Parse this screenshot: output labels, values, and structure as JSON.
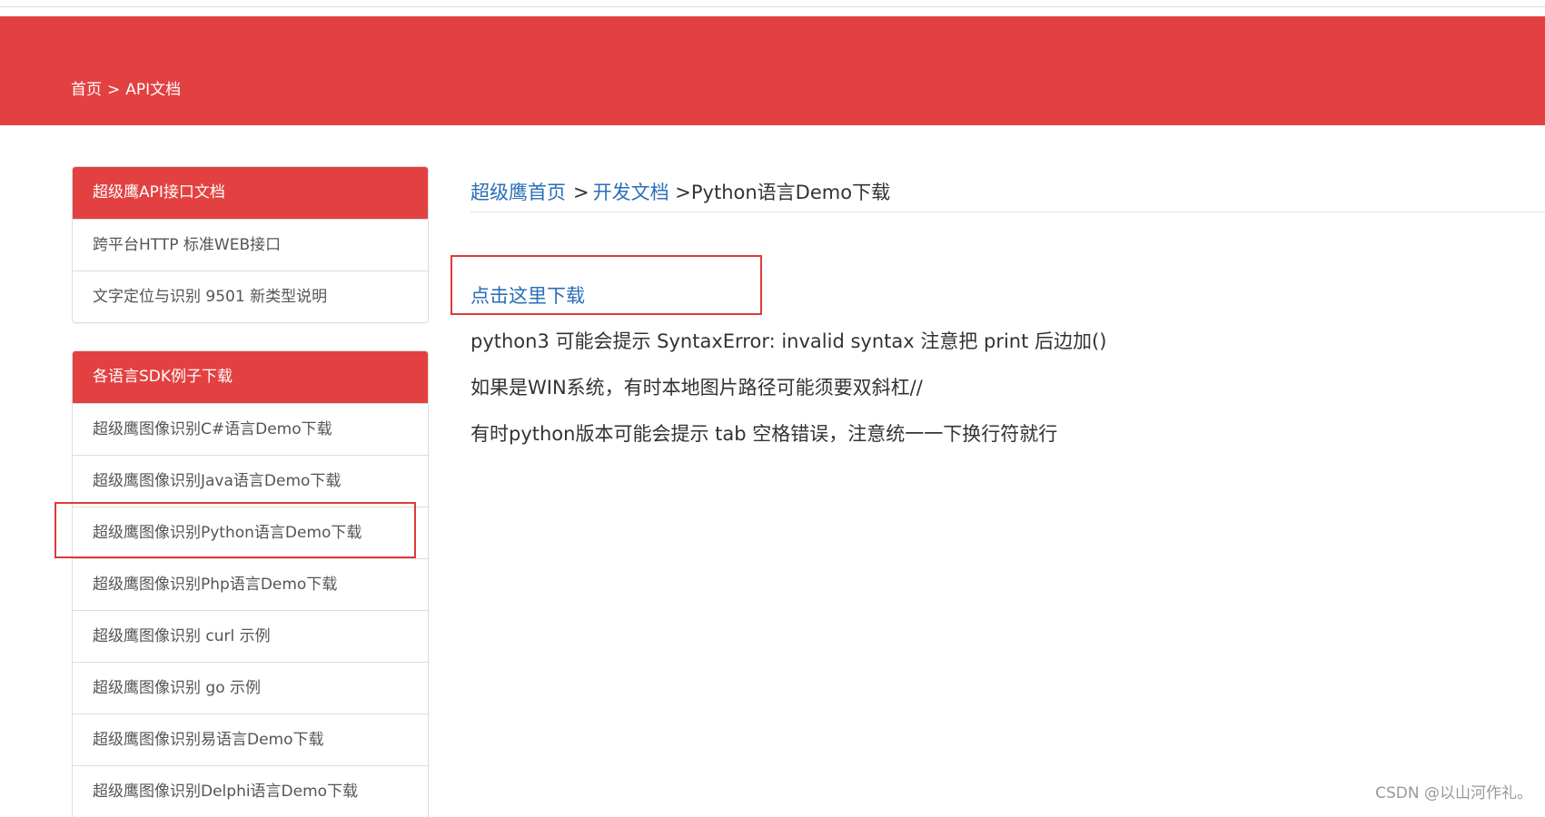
{
  "banner": {
    "breadcrumb_home": "首页",
    "breadcrumb_sep": ">",
    "breadcrumb_current": "API文档",
    "color": "#e34141"
  },
  "sidebar": {
    "panels": [
      {
        "title": "超级鹰API接口文档",
        "items": [
          "跨平台HTTP 标准WEB接口",
          "文字定位与识别 9501 新类型说明"
        ]
      },
      {
        "title": "各语言SDK例子下载",
        "items": [
          "超级鹰图像识别C#语言Demo下载",
          "超级鹰图像识别Java语言Demo下载",
          "超级鹰图像识别Python语言Demo下载",
          "超级鹰图像识别Php语言Demo下载",
          "超级鹰图像识别 curl 示例",
          "超级鹰图像识别 go 示例",
          "超级鹰图像识别易语言Demo下载",
          "超级鹰图像识别Delphi语言Demo下载"
        ]
      }
    ]
  },
  "content": {
    "breadcrumb": {
      "home": "超级鹰首页",
      "sep": ">",
      "docs": "开发文档",
      "current": ">Python语言Demo下载"
    },
    "download_link": "点击这里下载",
    "notes": [
      "python3 可能会提示 SyntaxError: invalid syntax  注意把 print 后边加()",
      "如果是WIN系统，有时本地图片路径可能须要双斜杠//",
      "有时python版本可能会提示 tab 空格错误，注意统一一下换行符就行"
    ],
    "link_color": "#2a6eb8"
  },
  "highlight_color": "#e03a3a",
  "watermark": "CSDN @以山河作礼。"
}
